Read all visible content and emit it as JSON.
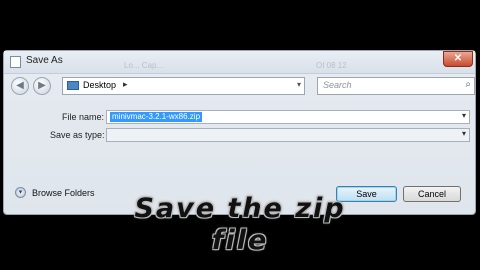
{
  "window": {
    "title": "Save As",
    "close_glyph": "✕",
    "ghost_left": "Lo...   Cap...",
    "ghost_right": "OI  08  12"
  },
  "nav": {
    "back_glyph": "◀",
    "forward_glyph": "▶",
    "location": "Desktop",
    "location_chevron": "▸",
    "dropdown_glyph": "▾",
    "refresh_glyph": "↻",
    "search_placeholder": "Search",
    "search_glyph": "⌕"
  },
  "form": {
    "file_name_label": "File name:",
    "file_name_value": "minivmac-3.2.1-wx86.zip",
    "save_type_label": "Save as type:",
    "save_type_value": "",
    "dropdown_glyph": "▾"
  },
  "footer": {
    "browse_label": "Browse Folders",
    "browse_glyph": "▾",
    "save_label": "Save",
    "cancel_label": "Cancel"
  },
  "overlay": {
    "line1": "Save the zip",
    "line2": "file"
  },
  "colors": {
    "selection": "#3399ff",
    "close_button": "#c94a2f",
    "background": "#000000"
  }
}
